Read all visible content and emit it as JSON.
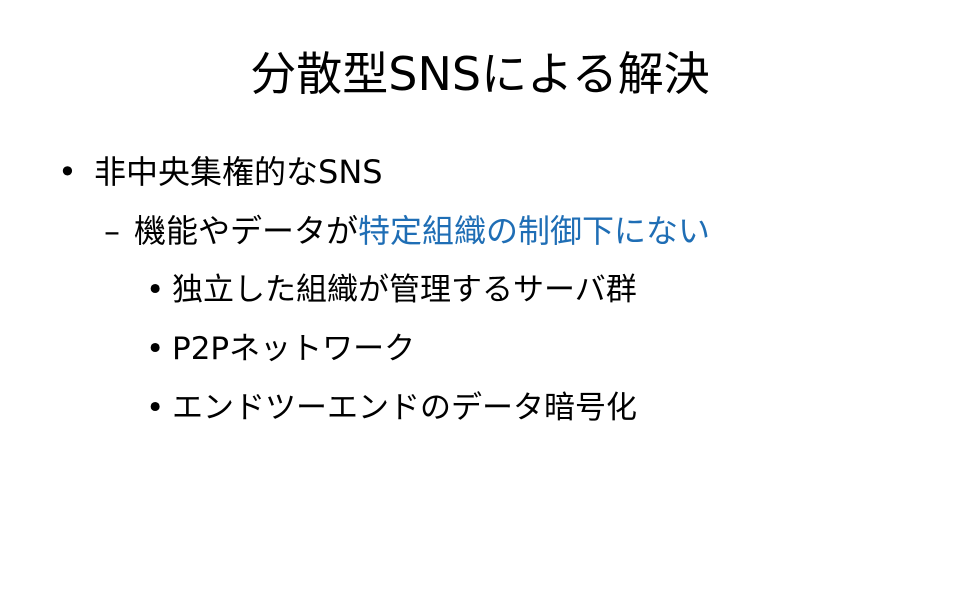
{
  "slide": {
    "title": "分散型SNSによる解決",
    "bullets": [
      {
        "marker": "•",
        "text": "非中央集権的なSNS"
      }
    ],
    "sub_bullet": {
      "marker": "–",
      "text_plain": "機能やデータが",
      "text_highlight": "特定組織の制御下にない"
    },
    "sub_sub_bullets": [
      {
        "marker": "•",
        "text": "独立した組織が管理するサーバ群"
      },
      {
        "marker": "•",
        "text": "P2Pネットワーク"
      },
      {
        "marker": "•",
        "text": "エンドツーエンドのデータ暗号化"
      }
    ]
  },
  "colors": {
    "text": "#000000",
    "accent": "#1f6eb5",
    "background": "#ffffff"
  }
}
